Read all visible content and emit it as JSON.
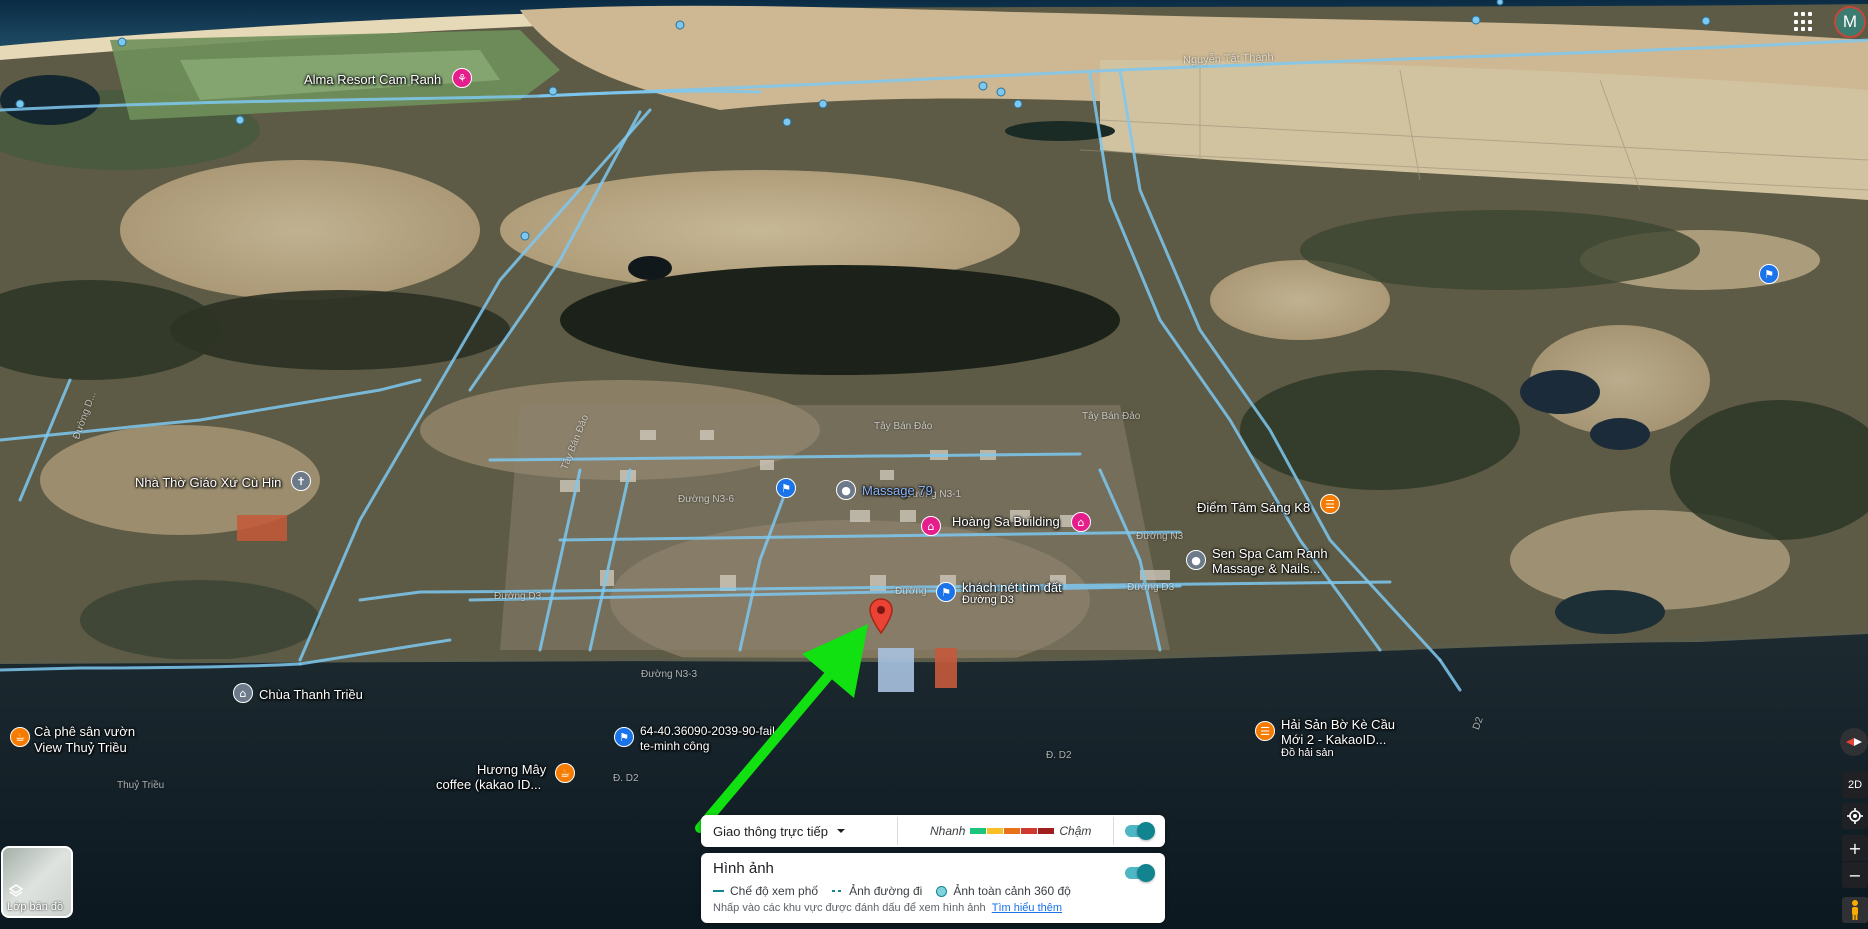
{
  "map": {
    "pois": [
      {
        "key": "alma",
        "name": "Alma Resort Cam Ranh",
        "color": "#e51e8c",
        "glyph": "⚘"
      },
      {
        "key": "church",
        "name": "Nhà Thờ Giáo Xứ Cù Hin",
        "color": "#6c7a89",
        "glyph": "✝"
      },
      {
        "key": "massage",
        "name": "Massage 79",
        "color": "#6c7a89",
        "glyph": "●"
      },
      {
        "key": "hoangsa",
        "name": "Hoàng Sa Building",
        "color": "#e51e8c",
        "glyph": "⌂"
      },
      {
        "key": "diemtam",
        "name": "Điểm Tâm Sáng K8",
        "color": "#f57c00",
        "glyph": "☰"
      },
      {
        "key": "senspa",
        "name": "Sen Spa Cam Ranh",
        "name2": "Massage & Nails...",
        "color": "#6c7a89",
        "glyph": "●"
      },
      {
        "key": "khach",
        "name": "khách nét tìm đất",
        "sub": "Đường D3",
        "color": "#1a73e8",
        "glyph": "⚑"
      },
      {
        "key": "chua",
        "name": "Chùa Thanh Triều",
        "color": "#6c7a89",
        "glyph": "⌂"
      },
      {
        "key": "caphe",
        "name": "Cà phê sân vườn",
        "name2": "View Thuỷ Triều",
        "color": "#f57c00",
        "glyph": "☕"
      },
      {
        "key": "phone",
        "name": "64-40.36090-2039-90-fail",
        "name2": "te-minh công",
        "color": "#1a73e8",
        "glyph": "⚑"
      },
      {
        "key": "huongmay",
        "name": "Hương Mây",
        "name2": "coffee (kakao ID...",
        "color": "#f57c00",
        "glyph": "☕"
      },
      {
        "key": "haisan",
        "name": "Hải Sản Bờ Kè Cầu",
        "name2": "Mới 2 - KakaoID...",
        "sub": "Đồ hải sản",
        "color": "#f57c00",
        "glyph": "☰"
      }
    ],
    "roads": {
      "nguyen_tat_thanh": "Nguyễn Tất Thành",
      "tay_ban_dao_1": "Tây Bán Đảo",
      "tay_ban_dao_2": "Tây Bán Đảo",
      "tay_ban_dao_3": "Tây Bán Đảo",
      "duong_d3_left": "Đường D3",
      "duong_d3_mid": "Đường",
      "duong_d3_right": "Đường D3",
      "duong_n3": "Đường N3",
      "duong_n3_3": "Đường N3-3",
      "duong_n3_6": "Đường N3-6",
      "duong_n3_1": "Đường N3-1",
      "d2": "D2",
      "d_d2_left": "Đ. D2",
      "d_d2_mid": "Đ. D2",
      "thuy_trieu": "Thuỷ Triều",
      "left_road": "Đường D..."
    }
  },
  "top_right": {
    "apps_icon": "apps-grid-icon",
    "avatar_letter": "M"
  },
  "layers_button": {
    "label": "Lớp bản đồ",
    "icon": "layers-icon"
  },
  "right_controls": {
    "compass": "compass-icon",
    "view_2d": "2D",
    "locate": "my-location-icon",
    "zoom_in": "+",
    "zoom_out": "−",
    "pegman": "pegman-icon"
  },
  "traffic_panel": {
    "dropdown_label": "Giao thông trực tiếp",
    "fast_label": "Nhanh",
    "slow_label": "Chậm",
    "scale_colors": [
      "#1bc47d",
      "#f6c026",
      "#e8711a",
      "#d1392f",
      "#a11e1e"
    ],
    "toggle_on": true
  },
  "imagery_panel": {
    "title": "Hình ảnh",
    "toggle_on": true,
    "legend": [
      {
        "label": "Chế độ xem phố",
        "kind": "solid-line"
      },
      {
        "label": "Ảnh đường đi",
        "kind": "dashed-line"
      },
      {
        "label": "Ảnh toàn cảnh 360 độ",
        "kind": "dot"
      }
    ],
    "note": "Nhấp vào các khu vực được đánh dấu để xem hình ảnh",
    "learn_more": "Tìm hiểu thêm"
  },
  "colors": {
    "accent": "#12848f",
    "street_view_line": "#7ec8f0",
    "marker_red": "#ea4335",
    "arrow_green": "#11e011"
  }
}
